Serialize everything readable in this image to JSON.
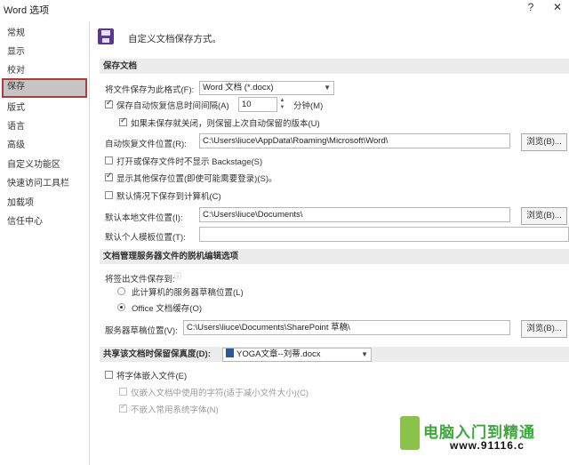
{
  "window": {
    "title": "Word 选项",
    "help": "?",
    "close": "✕"
  },
  "sidebar": {
    "items": [
      {
        "label": "常规"
      },
      {
        "label": "显示"
      },
      {
        "label": "校对"
      },
      {
        "label": "保存"
      },
      {
        "label": "版式"
      },
      {
        "label": "语言"
      },
      {
        "label": "高级"
      },
      {
        "label": "自定义功能区"
      },
      {
        "label": "快速访问工具栏"
      },
      {
        "label": "加载项"
      },
      {
        "label": "信任中心"
      }
    ]
  },
  "header": {
    "text": "自定义文档保存方式。"
  },
  "save_section": {
    "title": "保存文档",
    "format_label": "将文件保存为此格式(F):",
    "format_value": "Word 文档 (*.docx)",
    "autorecover_label": "保存自动恢复信息时间间隔(A)",
    "autorecover_value": "10",
    "minutes": "分钟(M)",
    "keep_last_label": "如果未保存就关闭，则保留上次自动保留的版本(U)",
    "autorecover_loc_label": "自动恢复文件位置(R):",
    "autorecover_loc_value": "C:\\Users\\liuce\\AppData\\Roaming\\Microsoft\\Word\\",
    "browse": "浏览(B)...",
    "backstage_label": "打开或保存文件时不显示 Backstage(S)",
    "show_other_label": "显示其他保存位置(即使可能需要登录)(S)。",
    "default_computer_label": "默认情况下保存到计算机(C)",
    "default_local_label": "默认本地文件位置(I):",
    "default_local_value": "C:\\Users\\liuce\\Documents\\",
    "personal_template_label": "默认个人模板位置(T):",
    "personal_template_value": ""
  },
  "offline_section": {
    "title": "文档管理服务器文件的脱机编辑选项",
    "checkout_label": "将签出文件保存到:",
    "info_icon": "ⓘ",
    "server_drafts_label": "此计算机的服务器草稿位置(L)",
    "office_cache_label": "Office 文档缓存(O)",
    "drafts_loc_label": "服务器草稿位置(V):",
    "drafts_loc_value": "C:\\Users\\liuce\\Documents\\SharePoint 草稿\\"
  },
  "fidelity_section": {
    "title": "共享该文档时保留保真度(D):",
    "doc_value": "YOGA文章--刘蒂.docx",
    "embed_fonts_label": "将字体嵌入文件(E)",
    "embed_used_label": "仅嵌入文档中使用的字符(适于减小文件大小)(C)",
    "no_common_label": "不嵌入常用系统字体(N)"
  },
  "watermark": {
    "brand": "电脑入门到精通",
    "url": "www.91116.c"
  },
  "colors": {
    "active_border": "#b73a3a",
    "section_bg": "#ececec",
    "icon_purple": "#5a3a8e"
  }
}
